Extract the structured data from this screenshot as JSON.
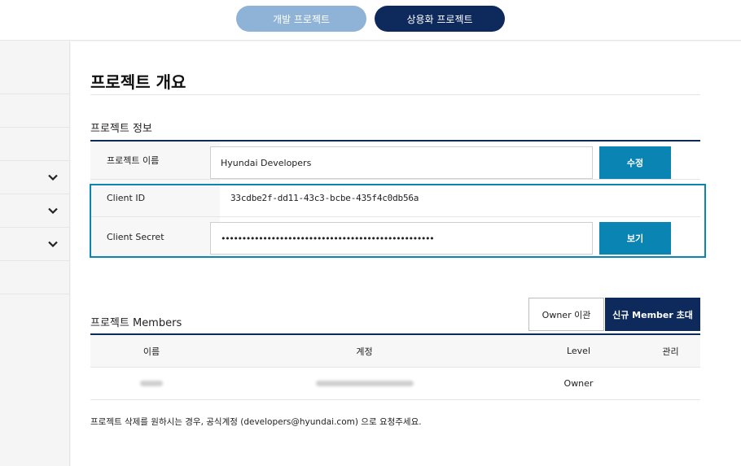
{
  "topbar": {
    "dev_tab": "개발 프로젝트",
    "commercial_tab": "상용화 프로젝트"
  },
  "page_title": "프로젝트 개요",
  "project_info": {
    "section_title": "프로젝트 정보",
    "name_label": "프로젝트 이름",
    "name_value": "Hyundai Developers",
    "edit_button": "수정",
    "client_id_label": "Client ID",
    "client_id_value": "33cdbe2f-dd11-43c3-bcbe-435f4c0db56a",
    "client_secret_label": "Client Secret",
    "client_secret_value": "•••••••••••••••••••••••••••••••••••••••••••••••••••",
    "view_button": "보기"
  },
  "members": {
    "section_title": "프로젝트 Members",
    "owner_transfer_button": "Owner 이관",
    "invite_button": "신규 Member 초대",
    "columns": [
      "이름",
      "계정",
      "Level",
      "관리"
    ],
    "rows": [
      {
        "level": "Owner"
      }
    ]
  },
  "footnote": "프로젝트 삭제를 원하시는 경우, 공식계정 (developers@hyundai.com) 으로 요청주세요.",
  "colors": {
    "navy": "#0e2a5c",
    "accent_blue": "#0a84b3",
    "light_blue": "#8fb3d6"
  }
}
